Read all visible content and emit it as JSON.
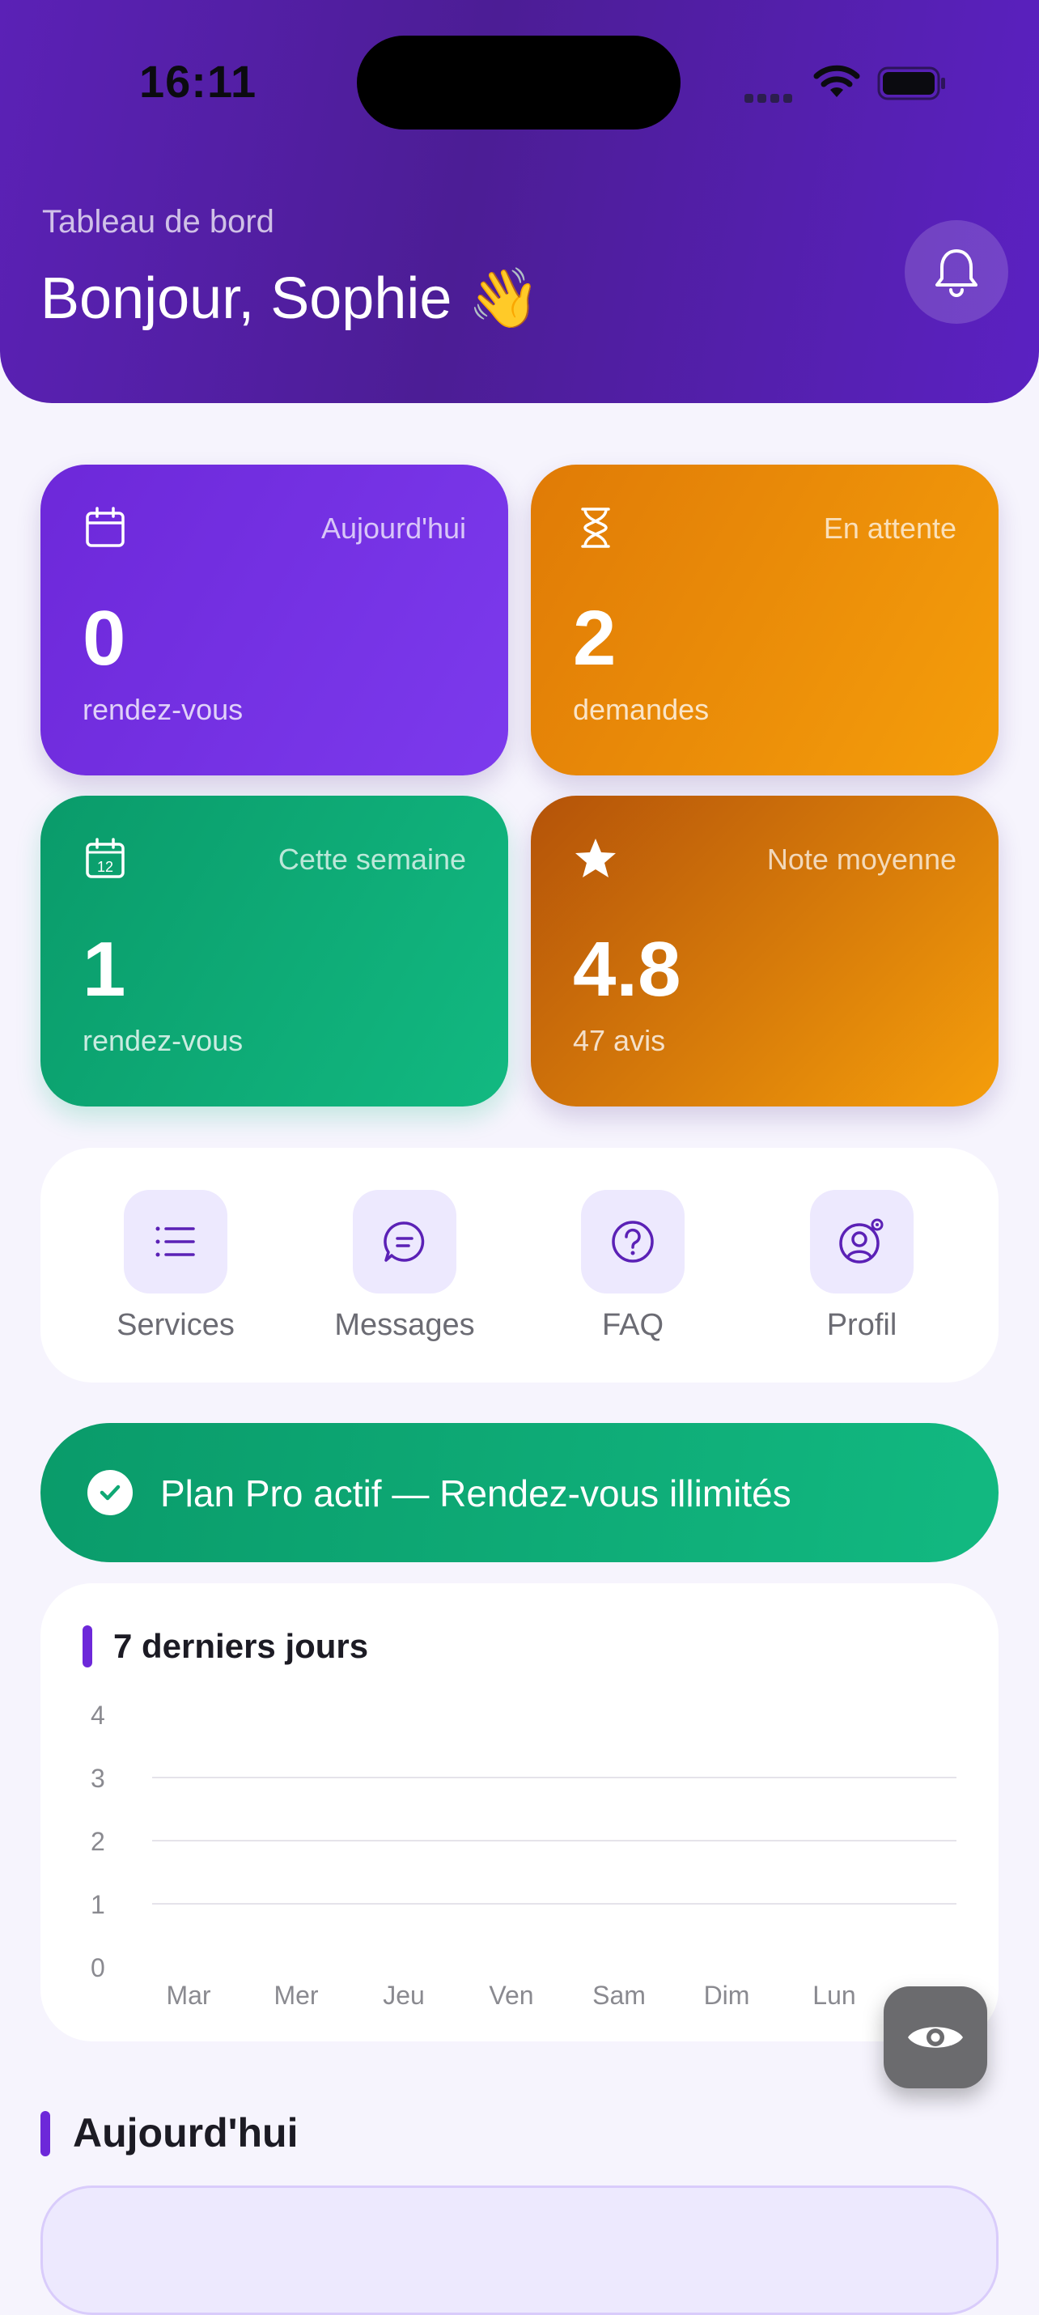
{
  "status_bar": {
    "time": "16:11"
  },
  "header": {
    "subtitle": "Tableau de bord",
    "greeting": "Bonjour, Sophie 👋"
  },
  "stats": [
    {
      "label": "Aujourd'hui",
      "value": "0",
      "unit": "rendez-vous",
      "icon": "calendar-icon",
      "color": "#6d28d9"
    },
    {
      "label": "En attente",
      "value": "2",
      "unit": "demandes",
      "icon": "hourglass-icon",
      "color": "#f59e0b"
    },
    {
      "label": "Cette semaine",
      "value": "1",
      "unit": "rendez-vous",
      "icon": "calendar-week-icon",
      "calendar_day": "12",
      "color": "#10b981"
    },
    {
      "label": "Note moyenne",
      "value": "4.8",
      "unit": "47 avis",
      "icon": "star-icon",
      "color": "#d97706"
    }
  ],
  "quick_actions": [
    {
      "label": "Services",
      "icon": "list-icon"
    },
    {
      "label": "Messages",
      "icon": "chat-icon"
    },
    {
      "label": "FAQ",
      "icon": "help-icon"
    },
    {
      "label": "Profil",
      "icon": "user-settings-icon"
    }
  ],
  "plan_banner": {
    "text": "Plan Pro actif — Rendez-vous illimités",
    "icon": "check-circle-icon"
  },
  "chart_data": {
    "type": "bar",
    "title": "7 derniers jours",
    "categories": [
      "Mar",
      "Mer",
      "Jeu",
      "Ven",
      "Sam",
      "Dim",
      "Lun"
    ],
    "values": [
      0,
      0,
      0,
      0,
      0,
      0,
      0
    ],
    "yticks": [
      "0",
      "1",
      "2",
      "3",
      "4"
    ],
    "ylim": [
      0,
      4
    ],
    "grid": true,
    "accent": "#6d28d9"
  },
  "today": {
    "title": "Aujourd'hui"
  },
  "fab": {
    "icon": "eye-icon"
  },
  "colors": {
    "primary": "#5b21b6",
    "success": "#10b981",
    "warning": "#f59e0b",
    "background": "#f6f4fd"
  }
}
